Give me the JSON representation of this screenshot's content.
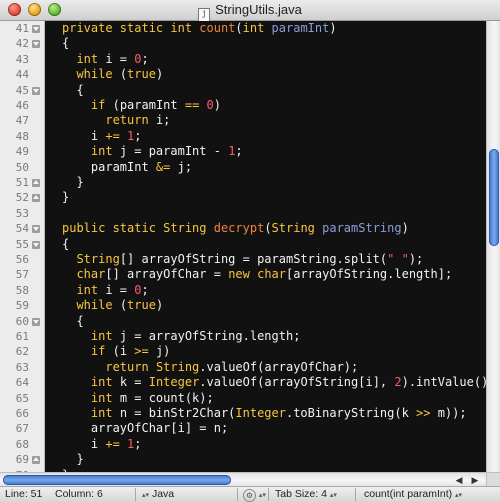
{
  "window": {
    "title": "StringUtils.java",
    "file_icon_glyph": "j"
  },
  "editor": {
    "lines": [
      {
        "num": "41",
        "fold": "down",
        "tokens": [
          [
            "kw",
            "private static int "
          ],
          [
            "fn",
            "count"
          ],
          [
            "pl",
            "("
          ],
          [
            "ty",
            "int "
          ],
          [
            "pr",
            "paramInt"
          ],
          [
            "pl",
            ")"
          ]
        ]
      },
      {
        "num": "42",
        "fold": "down",
        "tokens": [
          [
            "pl",
            "{"
          ]
        ]
      },
      {
        "num": "43",
        "fold": "",
        "tokens": [
          [
            "pl",
            "  "
          ],
          [
            "ty",
            "int "
          ],
          [
            "pl",
            "i = "
          ],
          [
            "nm",
            "0"
          ],
          [
            "pl",
            ";"
          ]
        ]
      },
      {
        "num": "44",
        "fold": "",
        "tokens": [
          [
            "pl",
            "  "
          ],
          [
            "kw",
            "while "
          ],
          [
            "pl",
            "("
          ],
          [
            "kw",
            "true"
          ],
          [
            "pl",
            ")"
          ]
        ]
      },
      {
        "num": "45",
        "fold": "down",
        "tokens": [
          [
            "pl",
            "  {"
          ]
        ]
      },
      {
        "num": "46",
        "fold": "",
        "tokens": [
          [
            "pl",
            "    "
          ],
          [
            "kw",
            "if "
          ],
          [
            "pl",
            "(paramInt "
          ],
          [
            "kw",
            "=="
          ],
          [
            "pl",
            " "
          ],
          [
            "nm",
            "0"
          ],
          [
            "pl",
            ")"
          ]
        ]
      },
      {
        "num": "47",
        "fold": "",
        "tokens": [
          [
            "pl",
            "      "
          ],
          [
            "kw",
            "return "
          ],
          [
            "pl",
            "i;"
          ]
        ]
      },
      {
        "num": "48",
        "fold": "",
        "tokens": [
          [
            "pl",
            "    i "
          ],
          [
            "kw",
            "+="
          ],
          [
            "pl",
            " "
          ],
          [
            "nm",
            "1"
          ],
          [
            "pl",
            ";"
          ]
        ]
      },
      {
        "num": "49",
        "fold": "",
        "tokens": [
          [
            "pl",
            "    "
          ],
          [
            "ty",
            "int "
          ],
          [
            "pl",
            "j = paramInt - "
          ],
          [
            "nm",
            "1"
          ],
          [
            "pl",
            ";"
          ]
        ]
      },
      {
        "num": "50",
        "fold": "",
        "tokens": [
          [
            "pl",
            "    paramInt "
          ],
          [
            "kw",
            "&="
          ],
          [
            "pl",
            " j;"
          ]
        ]
      },
      {
        "num": "51",
        "fold": "up",
        "tokens": [
          [
            "pl",
            "  }"
          ]
        ]
      },
      {
        "num": "52",
        "fold": "up",
        "tokens": [
          [
            "pl",
            "}"
          ]
        ]
      },
      {
        "num": "53",
        "fold": "",
        "tokens": []
      },
      {
        "num": "54",
        "fold": "down",
        "tokens": [
          [
            "kw",
            "public static "
          ],
          [
            "ty",
            "String "
          ],
          [
            "fn",
            "decrypt"
          ],
          [
            "pl",
            "("
          ],
          [
            "ty",
            "String "
          ],
          [
            "pr",
            "paramString"
          ],
          [
            "pl",
            ")"
          ]
        ]
      },
      {
        "num": "55",
        "fold": "down",
        "tokens": [
          [
            "pl",
            "{"
          ]
        ]
      },
      {
        "num": "56",
        "fold": "",
        "tokens": [
          [
            "pl",
            "  "
          ],
          [
            "ty",
            "String"
          ],
          [
            "pl",
            "[] arrayOfString = paramString.split("
          ],
          [
            "st",
            "\" \""
          ],
          [
            "pl",
            ");"
          ]
        ]
      },
      {
        "num": "57",
        "fold": "",
        "tokens": [
          [
            "pl",
            "  "
          ],
          [
            "ty",
            "char"
          ],
          [
            "pl",
            "[] arrayOfChar = "
          ],
          [
            "kw",
            "new "
          ],
          [
            "ty",
            "char"
          ],
          [
            "pl",
            "[arrayOfString.length];"
          ]
        ]
      },
      {
        "num": "58",
        "fold": "",
        "tokens": [
          [
            "pl",
            "  "
          ],
          [
            "ty",
            "int "
          ],
          [
            "pl",
            "i = "
          ],
          [
            "nm",
            "0"
          ],
          [
            "pl",
            ";"
          ]
        ]
      },
      {
        "num": "59",
        "fold": "",
        "tokens": [
          [
            "pl",
            "  "
          ],
          [
            "kw",
            "while "
          ],
          [
            "pl",
            "("
          ],
          [
            "kw",
            "true"
          ],
          [
            "pl",
            ")"
          ]
        ]
      },
      {
        "num": "60",
        "fold": "down",
        "tokens": [
          [
            "pl",
            "  {"
          ]
        ]
      },
      {
        "num": "61",
        "fold": "",
        "tokens": [
          [
            "pl",
            "    "
          ],
          [
            "ty",
            "int "
          ],
          [
            "pl",
            "j = arrayOfString.length;"
          ]
        ]
      },
      {
        "num": "62",
        "fold": "",
        "tokens": [
          [
            "pl",
            "    "
          ],
          [
            "kw",
            "if "
          ],
          [
            "pl",
            "(i "
          ],
          [
            "kw",
            ">="
          ],
          [
            "pl",
            " j)"
          ]
        ]
      },
      {
        "num": "63",
        "fold": "",
        "tokens": [
          [
            "pl",
            "      "
          ],
          [
            "kw",
            "return "
          ],
          [
            "ty",
            "String"
          ],
          [
            "pl",
            ".valueOf(arrayOfChar);"
          ]
        ]
      },
      {
        "num": "64",
        "fold": "",
        "tokens": [
          [
            "pl",
            "    "
          ],
          [
            "ty",
            "int "
          ],
          [
            "pl",
            "k = "
          ],
          [
            "ty",
            "Integer"
          ],
          [
            "pl",
            ".valueOf(arrayOfString[i], "
          ],
          [
            "nm",
            "2"
          ],
          [
            "pl",
            ").intValue();"
          ]
        ]
      },
      {
        "num": "65",
        "fold": "",
        "tokens": [
          [
            "pl",
            "    "
          ],
          [
            "ty",
            "int "
          ],
          [
            "pl",
            "m = count(k);"
          ]
        ]
      },
      {
        "num": "66",
        "fold": "",
        "tokens": [
          [
            "pl",
            "    "
          ],
          [
            "ty",
            "int "
          ],
          [
            "pl",
            "n = binStr2Char("
          ],
          [
            "ty",
            "Integer"
          ],
          [
            "pl",
            ".toBinaryString(k "
          ],
          [
            "kw",
            ">>"
          ],
          [
            "pl",
            " m));"
          ]
        ]
      },
      {
        "num": "67",
        "fold": "",
        "tokens": [
          [
            "pl",
            "    arrayOfChar[i] = n;"
          ]
        ]
      },
      {
        "num": "68",
        "fold": "",
        "tokens": [
          [
            "pl",
            "    i "
          ],
          [
            "kw",
            "+="
          ],
          [
            "pl",
            " "
          ],
          [
            "nm",
            "1"
          ],
          [
            "pl",
            ";"
          ]
        ]
      },
      {
        "num": "69",
        "fold": "up",
        "tokens": [
          [
            "pl",
            "  }"
          ]
        ]
      },
      {
        "num": "70",
        "fold": "up",
        "tokens": [
          [
            "pl",
            "}"
          ]
        ]
      }
    ]
  },
  "status_bar": {
    "line": "Line: 51",
    "column": "Column: 6",
    "language": "Java",
    "tab_size": "Tab Size:  4",
    "symbol": "count(int paramInt)",
    "updown_glyph": "▴▾",
    "gear_glyph": "⚙"
  },
  "colors": {
    "editor_background": "#111111",
    "keyword": "#f8c63e",
    "function_name": "#f0823a",
    "parameter": "#8a9fd8",
    "number_and_string": "#ff5a6a",
    "plain_text": "#f2f2f2",
    "scroll_thumb": "#4a80d8"
  }
}
